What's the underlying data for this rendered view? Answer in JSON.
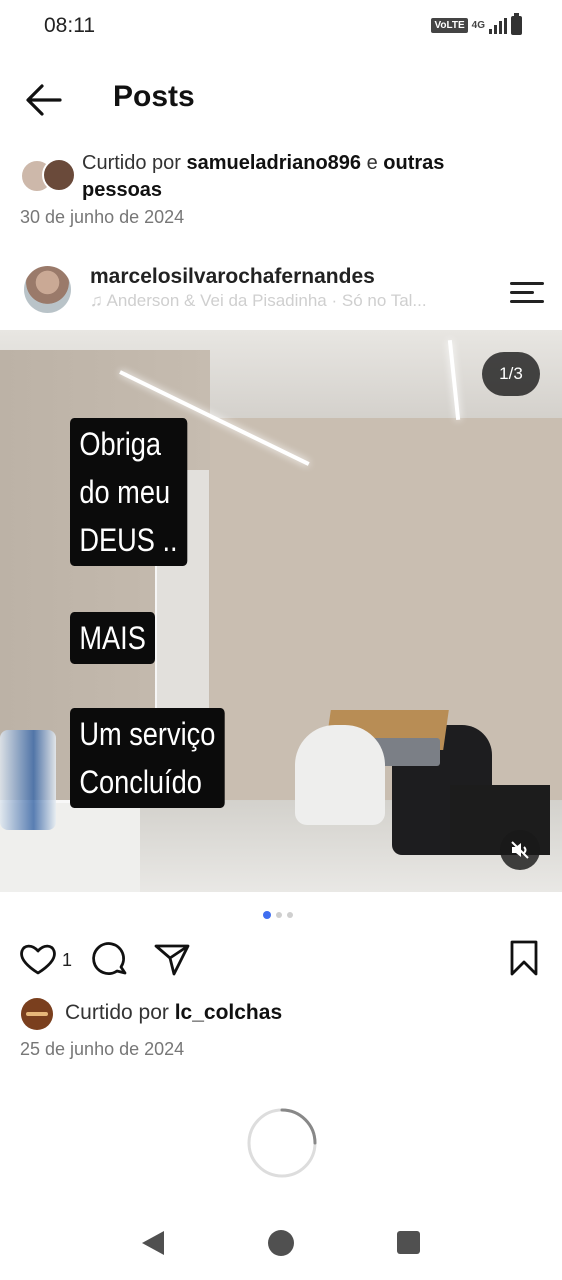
{
  "status_bar": {
    "time": "08:11",
    "volte_label": "VoLTE",
    "network_label": "4G"
  },
  "header": {
    "title": "Posts"
  },
  "liked_top": {
    "prefix": "Curtido por ",
    "user": "samueladriano896",
    "connector": " e ",
    "others": "outras pessoas",
    "date": "30 de junho de 2024"
  },
  "post": {
    "username": "marcelosilvarochafernandes",
    "music": "♫  Anderson & Vei da Pisadinha · Só no Tal...",
    "image_counter": "1/3",
    "overlay": {
      "line1": "Obriga",
      "line2": "do meu",
      "line3": "DEUS ..",
      "line4": "MAIS",
      "line5": "Um serviço",
      "line6": "Concluído"
    },
    "carousel": {
      "total": 3,
      "active": 1
    },
    "likes_count": "1",
    "liked_by": {
      "prefix": "Curtido por ",
      "user": "lc_colchas"
    },
    "date": "25 de junho de 2024"
  },
  "icons": {
    "back": "arrow-left-icon",
    "menu": "menu-icon",
    "like": "heart-icon",
    "comment": "comment-bubble-icon",
    "share": "send-icon",
    "save": "bookmark-icon",
    "mute": "volume-muted-icon"
  },
  "colors": {
    "accent": "#3f6ef0",
    "text": "#111111",
    "muted": "#777777"
  }
}
